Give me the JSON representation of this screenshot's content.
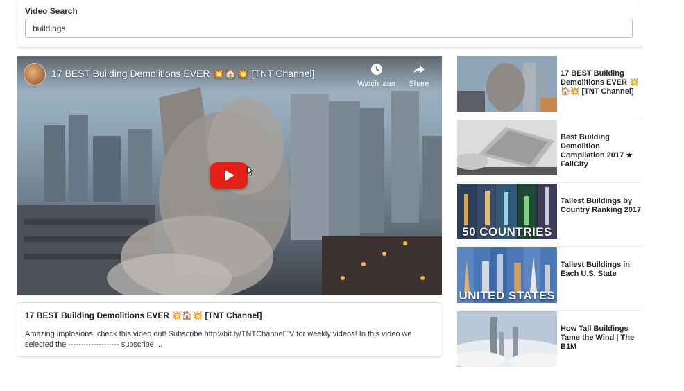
{
  "search": {
    "label": "Video Search",
    "value": "buildings"
  },
  "player": {
    "title": "17 BEST Building Demolitions EVER 💥🏠💥 [TNT Channel]",
    "watch_later_label": "Watch later",
    "share_label": "Share"
  },
  "detail": {
    "title": "17 BEST Building Demolitions EVER 💥🏠💥 [TNT Channel]",
    "description": "Amazing implosions, check this video out! Subscribe http://bit.ly/TNTChannelTV for weekly videos! In this video we selected the -------------------- subscribe ..."
  },
  "related": [
    {
      "title": "17 BEST Building Demolitions EVER 💥🏠💥 [TNT Channel]"
    },
    {
      "title": "Best Building Demolition Compilation 2017 ★ FailCity"
    },
    {
      "title": "Tallest Buildings by Country Ranking 2017",
      "thumb_caption": "50 COUNTRIES"
    },
    {
      "title": "Tallest Buildings in Each U.S. State",
      "thumb_caption": "UNITED STATES"
    },
    {
      "title": "How Tall Buildings Tame the Wind | The B1M"
    }
  ],
  "colors": {
    "play_button": "#e52117",
    "input_border": "#9fc3e0"
  }
}
